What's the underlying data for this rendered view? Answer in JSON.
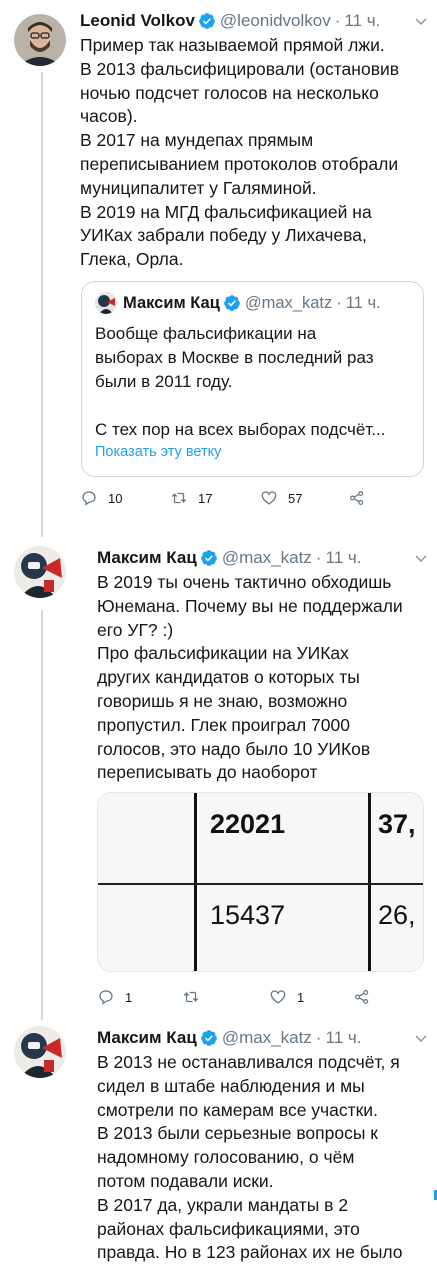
{
  "tweets": [
    {
      "name": "Leonid Volkov",
      "handle": "@leonidvolkov",
      "time": "11 ч.",
      "text": "Пример так называемой прямой лжи.\nВ 2013 фальсифицировали (остановив\nночью подсчет голосов на несколько\nчасов).\nВ 2017 на мундепах прямым\nпереписыванием протоколов отобрали\nмуниципалитет у Галяминой.\nВ 2019 на МГД фальсификацией на\nУИКах забрали победу у Лихачева,\nГлека, Орла.",
      "quote": {
        "name": "Максим Кац",
        "handle": "@max_katz",
        "time": "11 ч.",
        "text": "Вообще фальсификации на\nвыборах в Москве в последний раз\nбыли в 2011 году.\n\nС тех пор на всех выборах подсчёт...",
        "show_thread": "Показать эту ветку"
      },
      "replies": "10",
      "retweets": "17",
      "likes": "57"
    },
    {
      "name": "Максим Кац",
      "handle": "@max_katz",
      "time": "11 ч.",
      "text": "В 2019 ты очень тактично обходишь\nЮнемана. Почему вы не поддержали\nего УГ? :)\nПро фальсификации на УИКах\nдругих кандидатов о которых ты\nговоришь я не знаю, возможно\nпропустил. Глек проиграл 7000\nголосов, это надо было 10 УИКов\nпереписывать до наоборот",
      "media": {
        "row1_a": "22021",
        "row1_b": "37,",
        "row2_a": "15437",
        "row2_b": "26,"
      },
      "replies": "1",
      "retweets": "",
      "likes": "1"
    },
    {
      "name": "Максим Кац",
      "handle": "@max_katz",
      "time": "11 ч.",
      "text": "В 2013 не останавливался подсчёт, я\nсидел в штабе наблюдения и мы\nсмотрели по камерам все участки.\nВ 2013 были серьезные вопросы к\nнадомному голосованию, о чём\nпотом подавали иски.\nВ 2017 да, украли мандаты в 2\nрайонах фальсификациями, это\nправда. Но в 123 районах их не было"
    }
  ],
  "colors": {
    "accent": "#1da1f2",
    "secondary_text": "#657786",
    "border": "#ccd6dd"
  },
  "icons": [
    "verified-icon",
    "chevron-down-icon",
    "reply-icon",
    "retweet-icon",
    "like-icon",
    "share-icon"
  ]
}
